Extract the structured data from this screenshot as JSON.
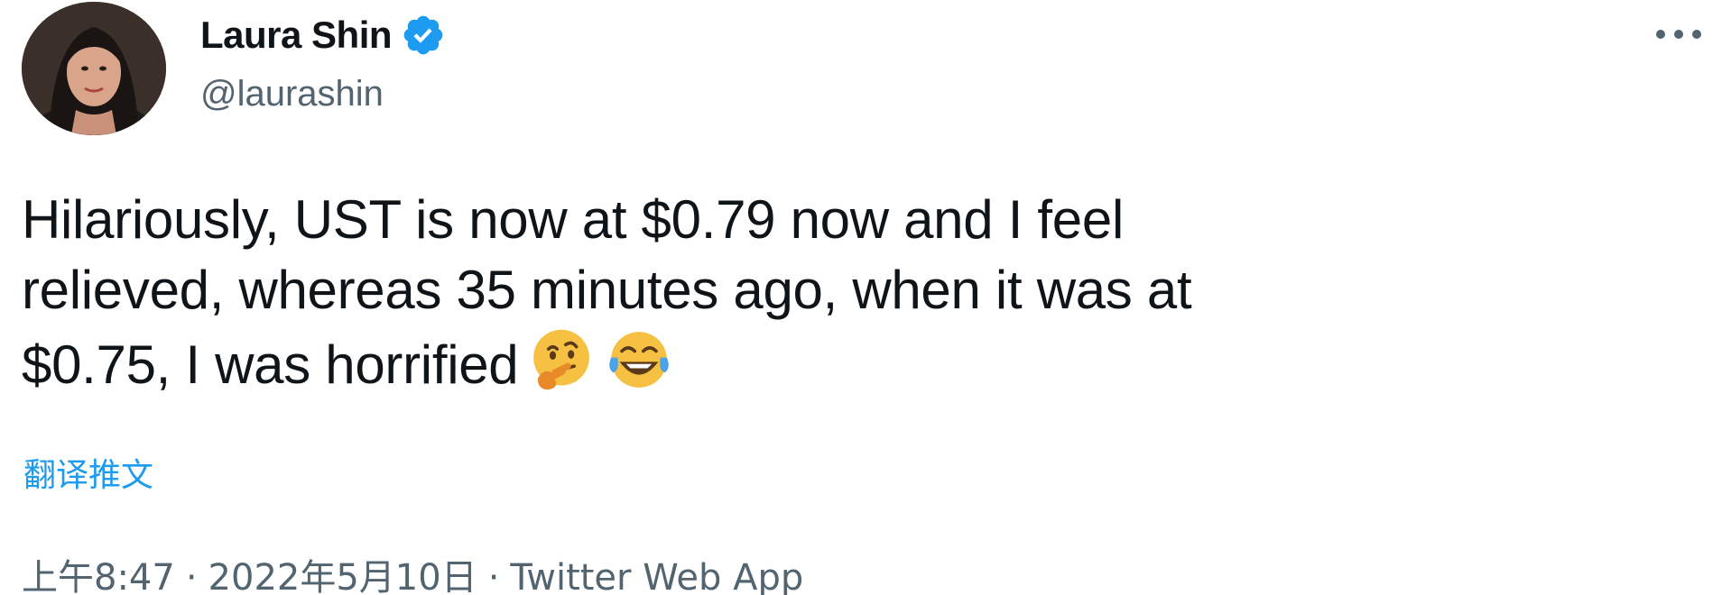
{
  "author": {
    "display_name": "Laura Shin",
    "handle": "@laurashin",
    "verified": true,
    "verified_color": "#1d9bf0"
  },
  "tweet": {
    "text_line_1": "Hilariously, UST is now at $0.79 now and I feel",
    "text_line_2": "relieved, whereas 35 minutes ago, when it was at",
    "text_line_3": "$0.75, I was horrified",
    "emojis": [
      "thinking-face-icon",
      "face-with-tears-of-joy-icon"
    ]
  },
  "translate_label": "翻译推文",
  "meta": {
    "time": "上午8:47",
    "separator": "·",
    "date": "2022年5月10日",
    "source": "Twitter Web App"
  },
  "colors": {
    "link": "#1d9bf0",
    "secondary_text": "#536471",
    "primary_text": "#0f1419"
  },
  "icons": {
    "more": "more-horizontal-icon",
    "verified": "verified-badge-icon"
  }
}
